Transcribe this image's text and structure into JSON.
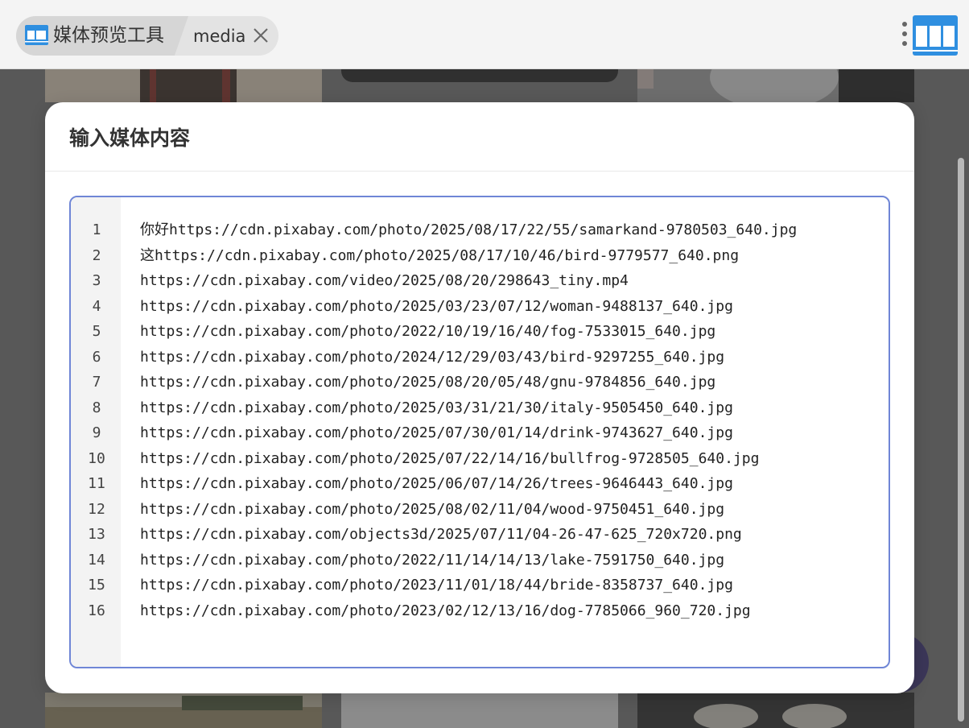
{
  "app": {
    "title": "媒体预览工具",
    "tab_label": "media"
  },
  "modal": {
    "title": "输入媒体内容"
  },
  "editor": {
    "lines": [
      "你好https://cdn.pixabay.com/photo/2025/08/17/22/55/samarkand-9780503_640.jpg",
      "这https://cdn.pixabay.com/photo/2025/08/17/10/46/bird-9779577_640.png",
      "https://cdn.pixabay.com/video/2025/08/20/298643_tiny.mp4",
      "https://cdn.pixabay.com/photo/2025/03/23/07/12/woman-9488137_640.jpg",
      "https://cdn.pixabay.com/photo/2022/10/19/16/40/fog-7533015_640.jpg",
      "https://cdn.pixabay.com/photo/2024/12/29/03/43/bird-9297255_640.jpg",
      "https://cdn.pixabay.com/photo/2025/08/20/05/48/gnu-9784856_640.jpg",
      "https://cdn.pixabay.com/photo/2025/03/31/21/30/italy-9505450_640.jpg",
      "https://cdn.pixabay.com/photo/2025/07/30/01/14/drink-9743627_640.jpg",
      "https://cdn.pixabay.com/photo/2025/07/22/14/16/bullfrog-9728505_640.jpg",
      "https://cdn.pixabay.com/photo/2025/06/07/14/26/trees-9646443_640.jpg",
      "https://cdn.pixabay.com/photo/2025/08/02/11/04/wood-9750451_640.jpg",
      "https://cdn.pixabay.com/objects3d/2025/07/11/04-26-47-625_720x720.png",
      "https://cdn.pixabay.com/photo/2022/11/14/14/13/lake-7591750_640.jpg",
      "https://cdn.pixabay.com/photo/2023/11/01/18/44/bride-8358737_640.jpg",
      "https://cdn.pixabay.com/photo/2023/02/12/13/16/dog-7785066_960_720.jpg"
    ],
    "line_numbers": [
      "1",
      "2",
      "3",
      "4",
      "5",
      "6",
      "7",
      "8",
      "9",
      "10",
      "11",
      "12",
      "13",
      "14",
      "15",
      "16"
    ]
  },
  "colors": {
    "accent": "#2f8fe0",
    "editor_border": "#6f86d6",
    "fab": "#3a2f7a"
  },
  "icons": {
    "app": "media-window-icon",
    "close": "close-icon",
    "more": "more-vertical-icon",
    "layout": "column-layout-icon"
  }
}
